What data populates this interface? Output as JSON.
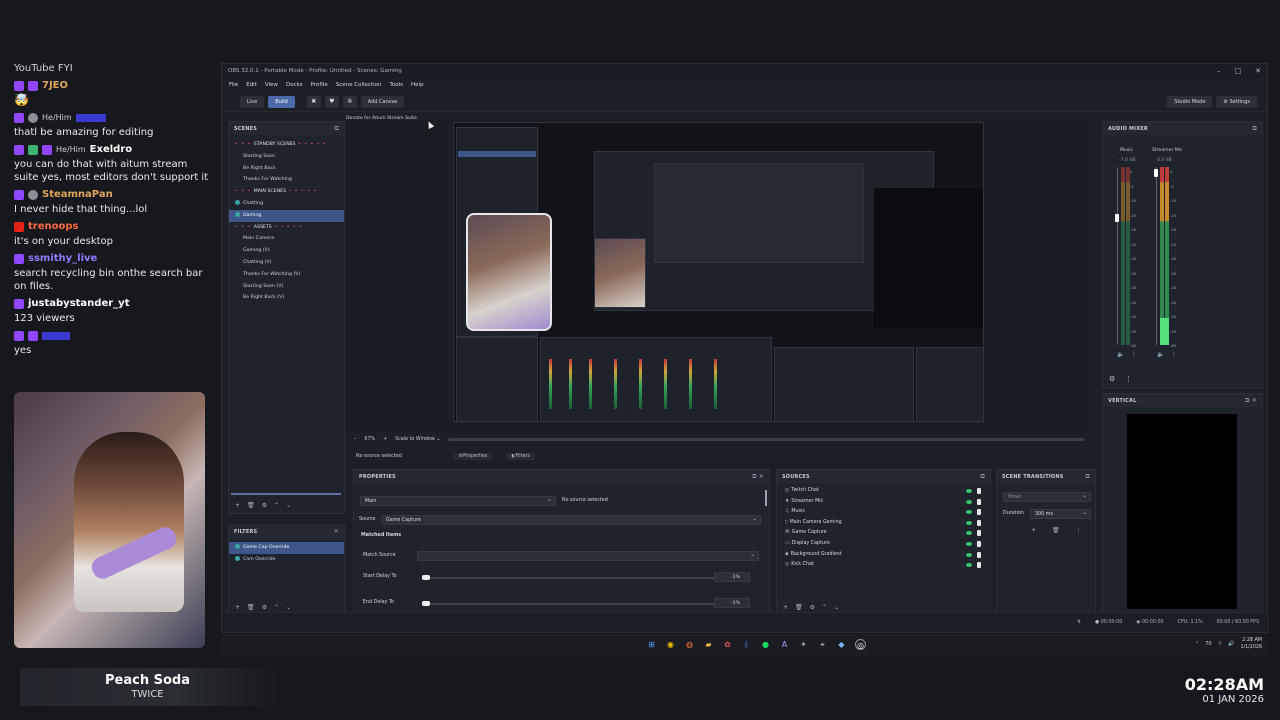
{
  "chat": {
    "top_line": "YouTube FYI",
    "messages": [
      {
        "badge": "purple",
        "user": "7JEO",
        "user_color": "#e0a75a",
        "pronoun": "",
        "text": ""
      },
      {
        "badge": "",
        "user": "",
        "user_color": "",
        "pronoun": "",
        "text": "🤯",
        "emoji": true
      },
      {
        "badge": "purple",
        "user": "",
        "user_color": "#5b5bd6",
        "pronoun": "He/Him",
        "text": "thatl be amazing for editing"
      },
      {
        "badge": "purple",
        "user": "Exeldro",
        "user_color": "#ffffff",
        "pronoun": "He/Him",
        "text": "you can do that with aitum stream suite yes, most editors don't support it"
      },
      {
        "badge": "purple",
        "user": "SteamnaPan",
        "user_color": "#e0a75a",
        "pronoun": "",
        "text": "I never hide that thing...lol"
      },
      {
        "badge": "red",
        "user": "trenoops",
        "user_color": "#ff6a3d",
        "pronoun": "",
        "text": "it's on your desktop"
      },
      {
        "badge": "purple",
        "user": "ssmithy_live",
        "user_color": "#8a7dff",
        "pronoun": "",
        "text": "search recycling bin onthe search bar on files."
      },
      {
        "badge": "purple",
        "user": "justabystander_yt",
        "user_color": "#ffffff",
        "pronoun": "",
        "text": "123 viewers"
      },
      {
        "badge": "purple",
        "user": "",
        "user_color": "#3d3df0",
        "pronoun": "",
        "text": "yes"
      }
    ]
  },
  "now_playing": {
    "title": "Peach Soda",
    "artist": "TWICE"
  },
  "clock": {
    "time": "02:28AM",
    "date": "01 JAN 2026"
  },
  "obs": {
    "title": "OBS 32.0.1 - Portable Mode - Profile: Untitled - Scenes: Gaming",
    "menu": [
      "File",
      "Edit",
      "View",
      "Docks",
      "Profile",
      "Scene Collection",
      "Tools",
      "Help"
    ],
    "toolbar": {
      "live_label": "Live",
      "build_label": "Build",
      "add_canvas_label": "Add Canvas",
      "donate_label": "Donate for Aitum Stream Suite",
      "studio_mode_label": "Studio Mode",
      "settings_label": "Settings"
    },
    "scenes": {
      "title": "SCENES",
      "items": [
        {
          "label": "STANDBY SCENES",
          "type": "header"
        },
        {
          "label": "Starting Soon",
          "type": "item"
        },
        {
          "label": "Be Right Back",
          "type": "item"
        },
        {
          "label": "Thanks For Watching",
          "type": "item"
        },
        {
          "label": "MAIN SCENES",
          "type": "header"
        },
        {
          "label": "Chatting",
          "type": "dot"
        },
        {
          "label": "Gaming",
          "type": "dot",
          "selected": true
        },
        {
          "label": "ASSETS",
          "type": "header"
        },
        {
          "label": "Main Camera",
          "type": "item"
        },
        {
          "label": "Gaming (V)",
          "type": "item"
        },
        {
          "label": "Chatting (V)",
          "type": "item"
        },
        {
          "label": "Thanks For Watching (V)",
          "type": "item"
        },
        {
          "label": "Starting Soon (V)",
          "type": "item"
        },
        {
          "label": "Be Right Back (V)",
          "type": "item"
        }
      ]
    },
    "filters": {
      "title": "FILTERS",
      "items": [
        {
          "label": "Game Cap Override",
          "selected": true
        },
        {
          "label": "Cam Override",
          "selected": false
        }
      ]
    },
    "preview": {
      "zoom": "67%",
      "scale_label": "Scale to Window",
      "no_source": "No source selected",
      "properties_btn": "Properties",
      "filters_btn": "Filters"
    },
    "properties": {
      "title": "PROPERTIES",
      "main_select": "Main",
      "no_source": "No source selected",
      "source_label": "Source",
      "source_value": "Game Capture",
      "matched_items": "Matched Items",
      "match_source": "Match Source",
      "start_delay_label": "Start Delay To",
      "start_delay_value": "-1%",
      "end_delay_label": "End Delay To",
      "end_delay_value": "-1%"
    },
    "sources": {
      "title": "SOURCES",
      "items": [
        {
          "label": "Twitch Chat",
          "icon": "globe-icon"
        },
        {
          "label": "Streamer Mic",
          "icon": "mic-icon"
        },
        {
          "label": "Music",
          "icon": "music-icon"
        },
        {
          "label": "Main Camera Gaming",
          "icon": "scene-icon"
        },
        {
          "label": "Game Capture",
          "icon": "gamepad-icon"
        },
        {
          "label": "Display Capture",
          "icon": "monitor-icon"
        },
        {
          "label": "Background Gradient",
          "icon": "paint-icon"
        },
        {
          "label": "Kick Chat",
          "icon": "globe-icon"
        }
      ]
    },
    "transitions": {
      "title": "SCENE TRANSITIONS",
      "transition": "Move",
      "duration_label": "Duration",
      "duration_value": "300 ms"
    },
    "audio_mixer": {
      "title": "AUDIO MIXER",
      "channels": [
        {
          "name": "Music",
          "db": "-7.0 dB"
        },
        {
          "name": "Streamer Mic",
          "db": "0.0 dB"
        }
      ],
      "scale": [
        "0",
        "-5",
        "-10",
        "-15",
        "-20",
        "-25",
        "-30",
        "-35",
        "-40",
        "-45",
        "-50",
        "-55",
        "-60"
      ]
    },
    "vertical": {
      "title": "VERTICAL"
    },
    "status": {
      "rec_time": "00:00:00",
      "stream_time": "00:00:00",
      "cpu": "CPU: 1.1%",
      "fps": "60.00 / 60.00 FPS"
    }
  },
  "taskbar": {
    "temp": "70",
    "time": "2:28 AM",
    "date": "1/1/2026"
  },
  "colors": {
    "accent": "#4b6aa8",
    "selected_row": "#3e5689",
    "panel_bg": "#1f232b",
    "live_green": "#3cc46a"
  }
}
